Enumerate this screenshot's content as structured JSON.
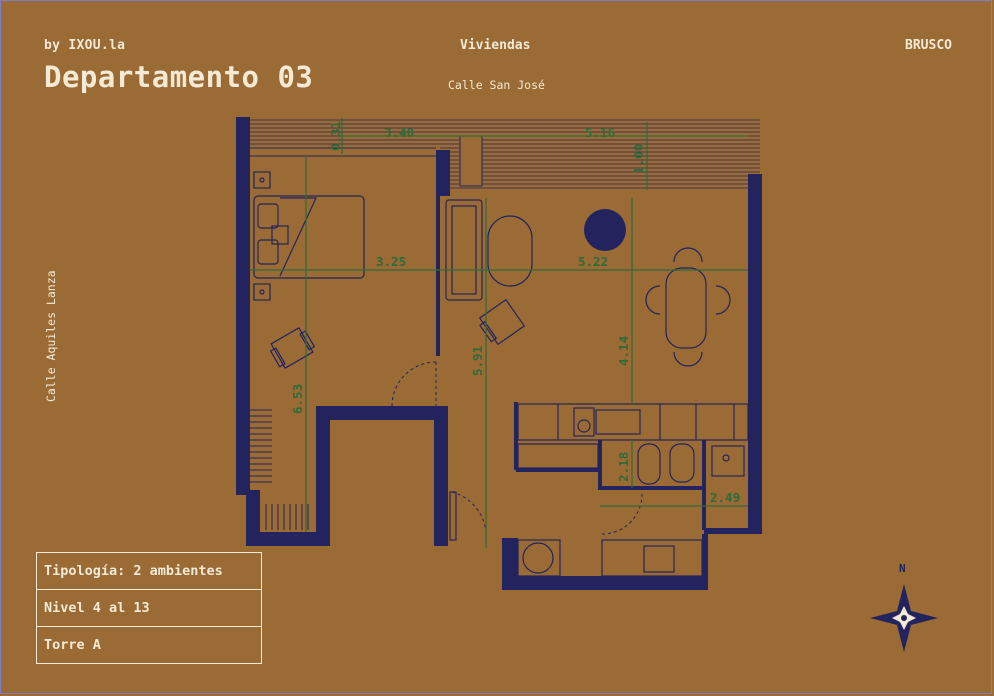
{
  "header": {
    "brand": "by IXOU.la",
    "title": "Departamento 03",
    "section": "Viviendas",
    "project": "BRUSCO"
  },
  "streets": {
    "top": "Calle San José",
    "left": "Calle Aquiles Lanza"
  },
  "dimensions": [
    "0.31",
    "3.40",
    "5.16",
    "1.00",
    "3.25",
    "5.22",
    "6.53",
    "5.91",
    "4.14",
    "2.18",
    "2.49"
  ],
  "info": {
    "tipologia": "Tipología: 2 ambientes",
    "nivel": "Nivel 4 al 13",
    "torre": "Torre A"
  },
  "compass": {
    "label": "N"
  },
  "colors": {
    "background": "#9a6b34",
    "walls": "#23245e",
    "dimension_lines": "#2e6b3c",
    "text": "#f4ead6"
  }
}
